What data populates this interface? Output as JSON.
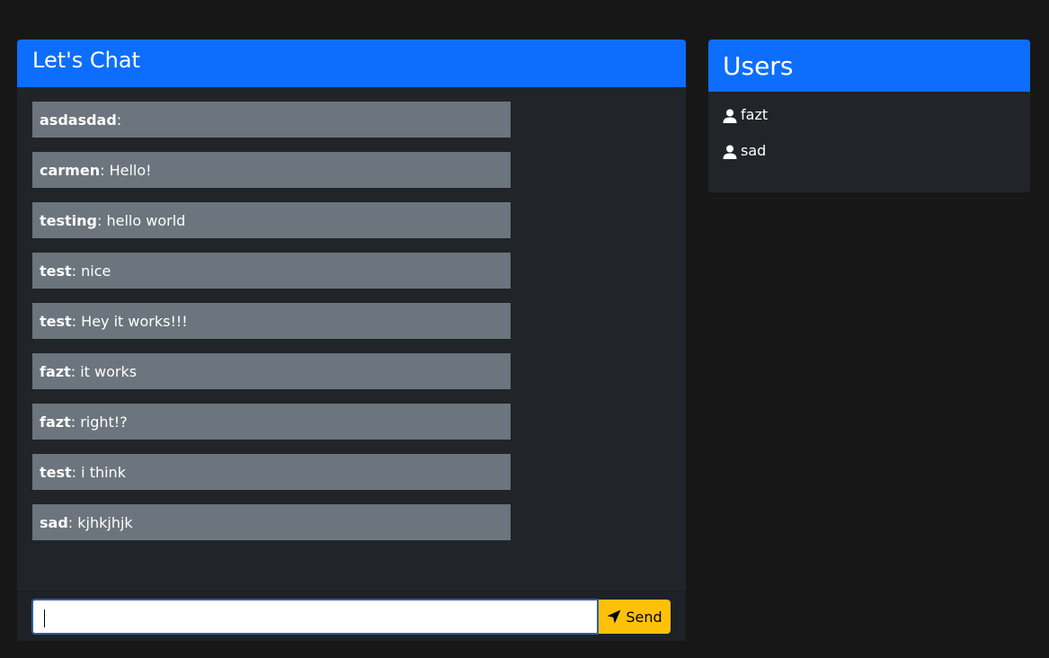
{
  "chat": {
    "title": "Let's Chat",
    "messages": [
      {
        "author": "asdasdad",
        "text": ""
      },
      {
        "author": "carmen",
        "text": "Hello!"
      },
      {
        "author": "testing",
        "text": "hello world"
      },
      {
        "author": "test",
        "text": "nice"
      },
      {
        "author": "test",
        "text": "Hey it works!!!"
      },
      {
        "author": "fazt",
        "text": "it works"
      },
      {
        "author": "fazt",
        "text": "right!?"
      },
      {
        "author": "test",
        "text": "i think"
      },
      {
        "author": "sad",
        "text": "kjhkjhjk"
      }
    ],
    "separator": ":",
    "input": {
      "value": "",
      "placeholder": ""
    },
    "send_label": "Send",
    "send_icon": "paper-plane-icon"
  },
  "users": {
    "title": "Users",
    "user_icon": "user-icon",
    "list": [
      {
        "name": "fazt"
      },
      {
        "name": "sad"
      }
    ]
  },
  "colors": {
    "background": "#171717",
    "card": "#212529",
    "header": "#0d6efd",
    "message": "#6c757d",
    "send_button": "#ffc107"
  }
}
